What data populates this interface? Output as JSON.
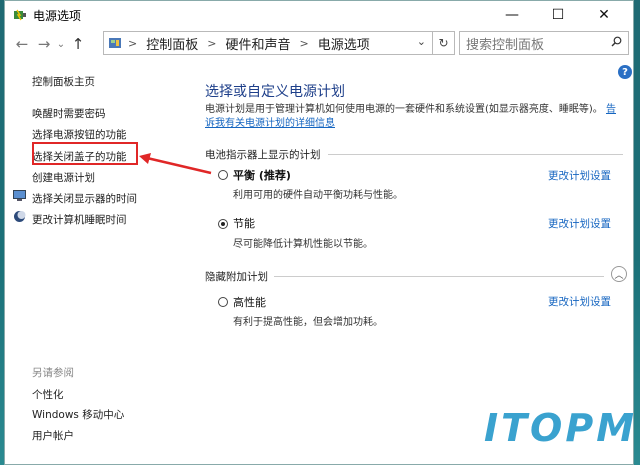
{
  "window": {
    "title": "电源选项",
    "minimize_label": "—",
    "maximize_label": "☐",
    "close_label": "✕"
  },
  "nav": {
    "back_label": "←",
    "forward_label": "→",
    "down_label": "⌄",
    "up_label": "↑",
    "breadcrumbs": [
      "控制面板",
      "硬件和声音",
      "电源选项"
    ],
    "separator": ">",
    "dropdown_label": "⌄",
    "refresh_label": "↻",
    "search_placeholder": "搜索控制面板"
  },
  "left": {
    "home": "控制面板主页",
    "links": [
      "唤醒时需要密码",
      "选择电源按钮的功能",
      "选择关闭盖子的功能",
      "创建电源计划",
      "选择关闭显示器的时间",
      "更改计算机睡眠时间"
    ],
    "see_also_title": "另请参阅",
    "see_also": [
      "个性化",
      "Windows 移动中心",
      "用户帐户"
    ]
  },
  "main": {
    "heading": "选择或自定义电源计划",
    "description": "电源计划是用于管理计算机如何使用电源的一套硬件和系统设置(如显示器亮度、睡眠等)。",
    "description_link": "告诉我有关电源计划的详细信息",
    "section_battery": "电池指示器上显示的计划",
    "section_hidden": "隐藏附加计划",
    "change_label": "更改计划设置",
    "plans": [
      {
        "name": "平衡 (推荐)",
        "desc": "利用可用的硬件自动平衡功耗与性能。",
        "selected": false
      },
      {
        "name": "节能",
        "desc": "尽可能降低计算机性能以节能。",
        "selected": true
      },
      {
        "name": "高性能",
        "desc": "有利于提高性能，但会增加功耗。",
        "selected": false
      }
    ]
  },
  "help_label": "?",
  "watermark": "ITOPM"
}
